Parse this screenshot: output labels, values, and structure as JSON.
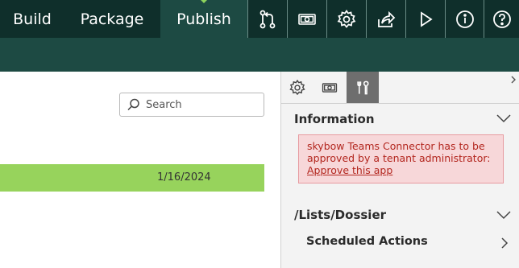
{
  "topbar": {
    "tabs": [
      {
        "label": "Build"
      },
      {
        "label": "Package"
      },
      {
        "label": "Publish",
        "active": true
      }
    ],
    "icons": [
      "merge-request-icon",
      "money-icon",
      "gear-icon",
      "share-icon",
      "play-icon",
      "info-icon",
      "help-icon"
    ]
  },
  "main": {
    "search": {
      "placeholder": "Search",
      "value": ""
    },
    "row": {
      "date": "1/16/2024"
    }
  },
  "panel": {
    "tabs": [
      "gear-icon",
      "money-icon",
      "tools-icon"
    ],
    "active_tab": "tools-icon",
    "information": {
      "title": "Information",
      "message": "skybow Teams Connector has to be approved by a tenant administrator:",
      "link": "Approve this app"
    },
    "list": {
      "title": "/Lists/Dossier",
      "sub_title": "Scheduled Actions"
    }
  },
  "colors": {
    "topbar": "#0f2f2b",
    "subbar": "#1d4a43",
    "accent_green": "#97d35c",
    "error_bg": "#f7d7d9",
    "error_text": "#b3261e"
  }
}
